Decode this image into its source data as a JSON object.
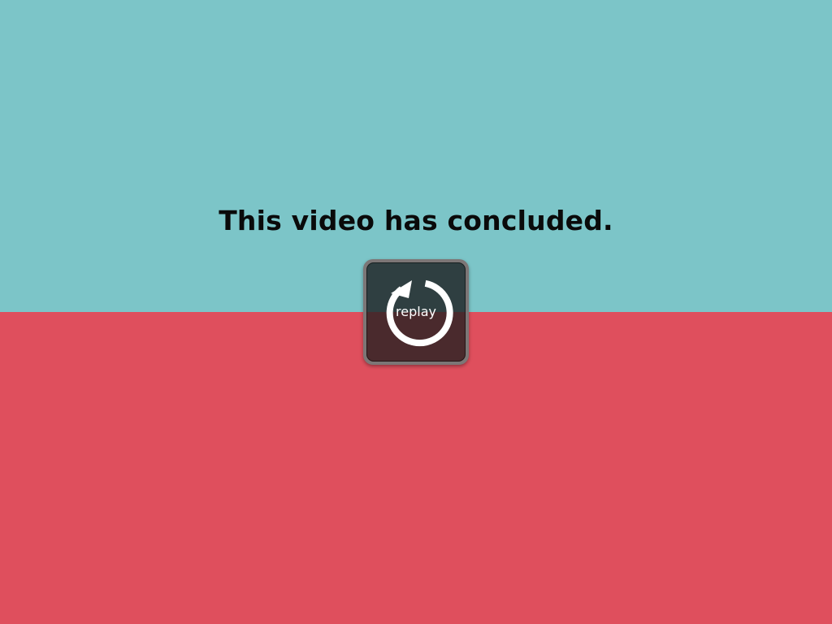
{
  "player": {
    "end_message": "This video has concluded.",
    "replay_label": "replay",
    "replay_icon": "replay-arrow-icon"
  },
  "colors": {
    "top_background": "#7cc5c8",
    "bottom_background": "#df4f5d",
    "message_text": "#0a0a0a",
    "button_frame": "#7c7676",
    "button_face_top": "#2f3f41",
    "button_face_bottom": "#4a2a2d",
    "icon": "#ffffff"
  }
}
